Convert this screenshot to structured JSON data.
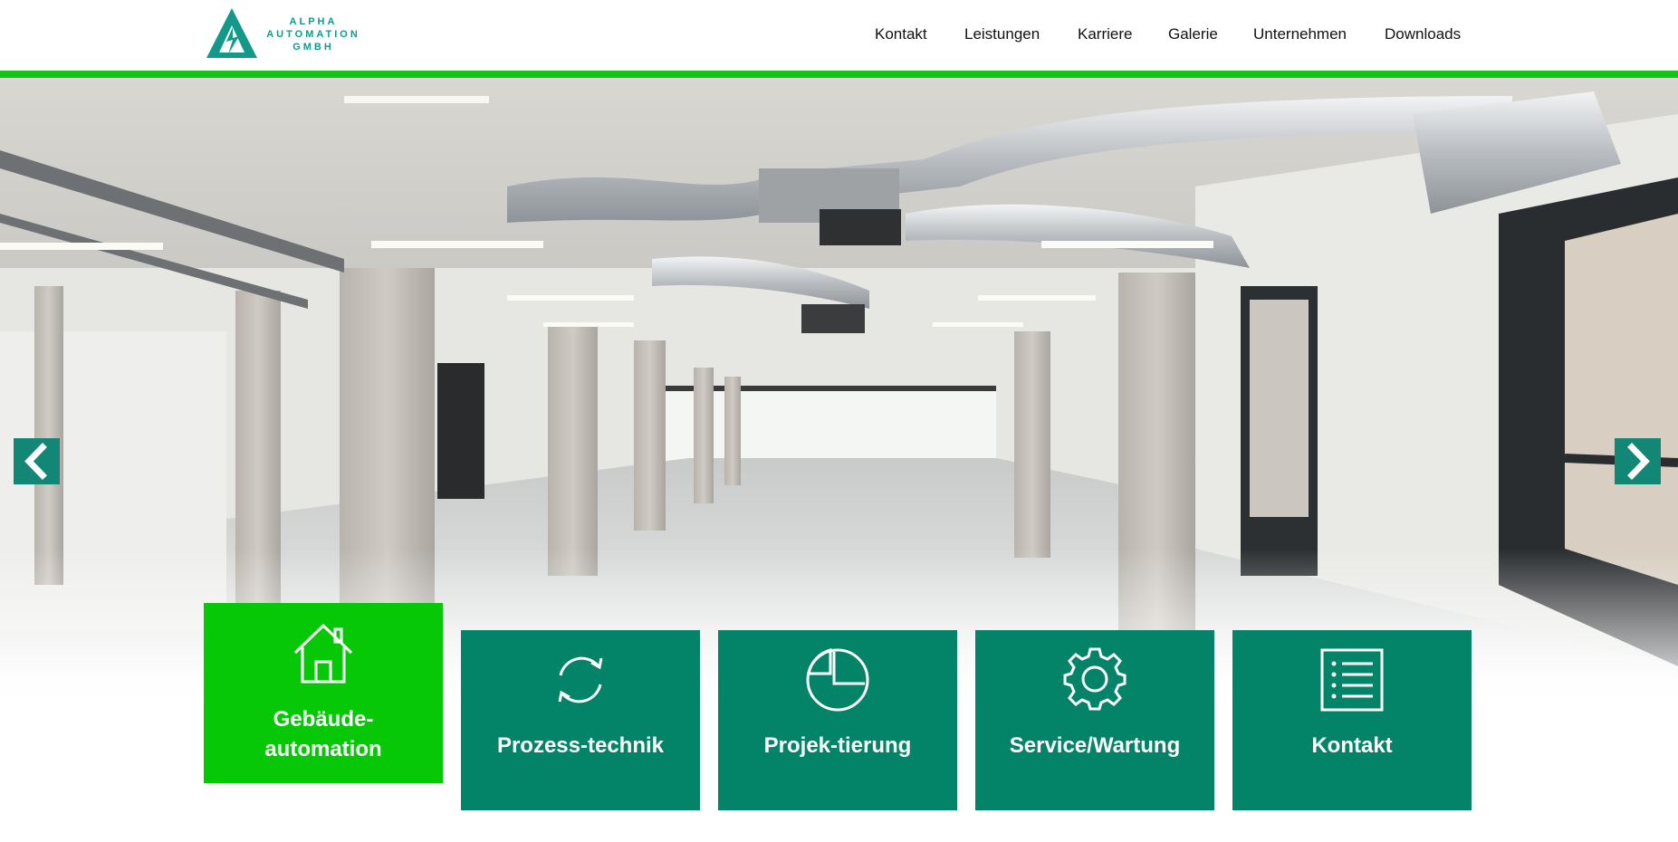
{
  "brand": {
    "line1": "ALPHA",
    "line2": "AUTOMATION",
    "line3": "GMBH",
    "color": "#13998a"
  },
  "nav": {
    "items": [
      {
        "label": "Kontakt"
      },
      {
        "label": "Leistungen"
      },
      {
        "label": "Karriere"
      },
      {
        "label": "Galerie"
      },
      {
        "label": "Unternehmen"
      },
      {
        "label": "Downloads"
      }
    ]
  },
  "slider": {
    "prev_icon": "chevron-left-icon",
    "next_icon": "chevron-right-icon",
    "accent": "#138775"
  },
  "tiles": [
    {
      "label": "Gebäude-automation",
      "line1": "Gebäude-",
      "line2": "automation",
      "icon": "house-icon",
      "active": true,
      "color": "#07c807"
    },
    {
      "label": "Prozess-technik",
      "icon": "refresh-cycle-icon",
      "active": false,
      "color": "#038469"
    },
    {
      "label": "Projek-tierung",
      "icon": "pie-chart-icon",
      "active": false,
      "color": "#038469"
    },
    {
      "label": "Service/Wartung",
      "icon": "gear-icon",
      "active": false,
      "color": "#038469"
    },
    {
      "label": "Kontakt",
      "icon": "list-icon",
      "active": false,
      "color": "#038469"
    }
  ],
  "colors": {
    "accent_green": "#16c316",
    "tile_green": "#038469"
  }
}
